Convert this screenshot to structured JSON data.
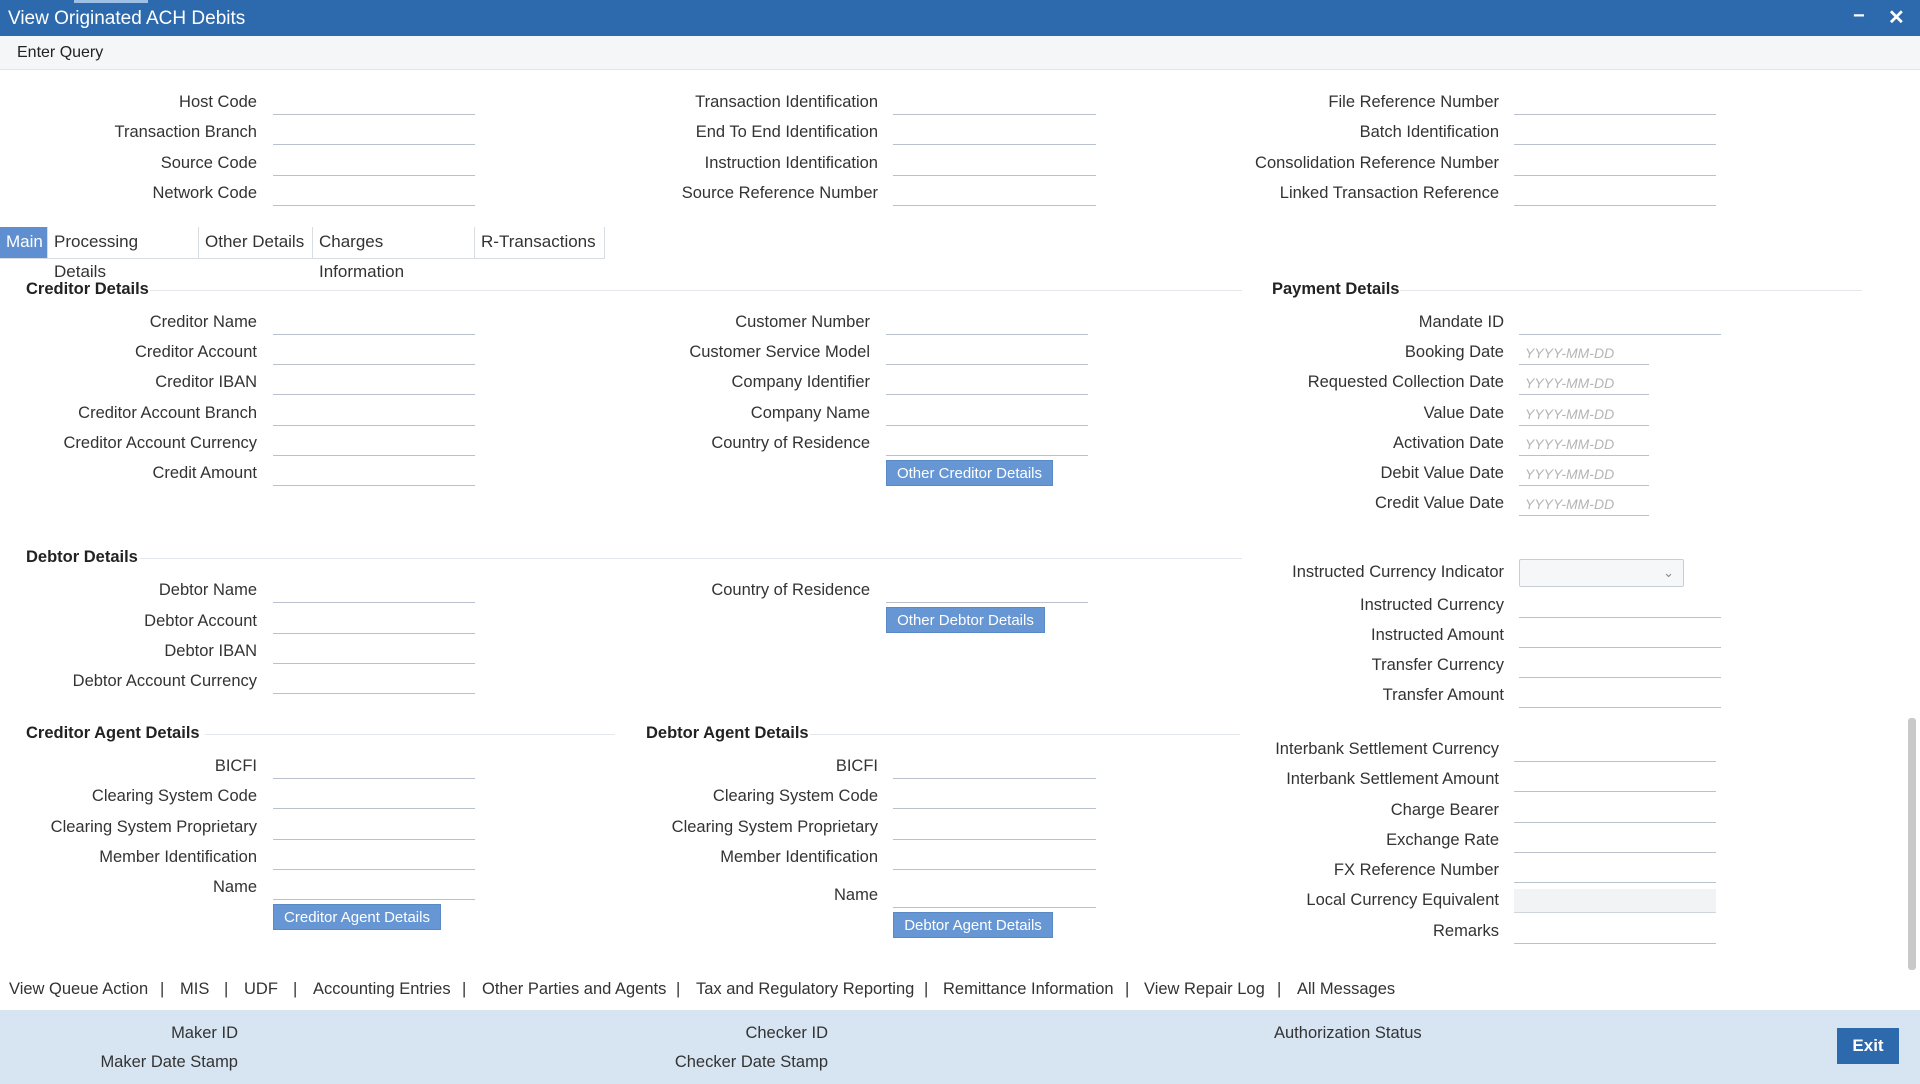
{
  "window": {
    "title": "View Originated ACH Debits",
    "minimize": "−",
    "close": "✕"
  },
  "query": {
    "enter_query": "Enter Query"
  },
  "header_fields": {
    "host_code": "Host Code",
    "transaction_branch": "Transaction Branch",
    "source_code": "Source Code",
    "network_code": "Network Code",
    "transaction_identification": "Transaction Identification",
    "end_to_end_identification": "End To End Identification",
    "instruction_identification": "Instruction Identification",
    "source_reference_number": "Source Reference Number",
    "file_reference_number": "File Reference Number",
    "batch_identification": "Batch Identification",
    "consolidation_reference_number": "Consolidation Reference Number",
    "linked_transaction_reference": "Linked Transaction Reference"
  },
  "tabs": [
    "Main",
    "Processing Details",
    "Other Details",
    "Charges Information",
    "R-Transactions"
  ],
  "creditor_details": {
    "title": "Creditor Details",
    "creditor_name": "Creditor Name",
    "creditor_account": "Creditor Account",
    "creditor_iban": "Creditor IBAN",
    "creditor_account_branch": "Creditor Account Branch",
    "creditor_account_currency": "Creditor Account Currency",
    "credit_amount": "Credit Amount",
    "customer_number": "Customer Number",
    "customer_service_model": "Customer Service Model",
    "company_identifier": "Company Identifier",
    "company_name": "Company Name",
    "country_of_residence": "Country of Residence",
    "other_creditor_details_button": "Other Creditor Details"
  },
  "payment_details": {
    "title": "Payment Details",
    "mandate_id": "Mandate ID",
    "booking_date": "Booking Date",
    "requested_collection_date": "Requested Collection Date",
    "value_date": "Value Date",
    "activation_date": "Activation Date",
    "debit_value_date": "Debit Value Date",
    "credit_value_date": "Credit Value Date",
    "date_placeholder": "YYYY-MM-DD",
    "instructed_currency_indicator": "Instructed Currency Indicator",
    "instructed_currency": "Instructed Currency",
    "instructed_amount": "Instructed Amount",
    "transfer_currency": "Transfer Currency",
    "transfer_amount": "Transfer Amount",
    "interbank_settlement_currency": "Interbank Settlement Currency",
    "interbank_settlement_amount": "Interbank Settlement Amount",
    "charge_bearer": "Charge Bearer",
    "exchange_rate": "Exchange Rate",
    "fx_reference_number": "FX Reference Number",
    "local_currency_equivalent": "Local Currency Equivalent",
    "remarks": "Remarks"
  },
  "debtor_details": {
    "title": "Debtor Details",
    "debtor_name": "Debtor Name",
    "debtor_account": "Debtor Account",
    "debtor_iban": "Debtor IBAN",
    "debtor_account_currency": "Debtor Account Currency",
    "country_of_residence": "Country of Residence",
    "other_debtor_details_button": "Other Debtor Details"
  },
  "creditor_agent": {
    "title": "Creditor Agent Details",
    "bicfi": "BICFI",
    "clearing_system_code": "Clearing System Code",
    "clearing_system_proprietary": "Clearing System Proprietary",
    "member_identification": "Member Identification",
    "name": "Name",
    "button": "Creditor Agent Details"
  },
  "debtor_agent": {
    "title": "Debtor Agent Details",
    "bicfi": "BICFI",
    "clearing_system_code": "Clearing System Code",
    "clearing_system_proprietary": "Clearing System Proprietary",
    "member_identification": "Member Identification",
    "name": "Name",
    "button": "Debtor Agent Details"
  },
  "bottom_links": [
    "View Queue Action",
    "MIS",
    "UDF",
    "Accounting Entries",
    "Other Parties and Agents",
    "Tax and Regulatory Reporting",
    "Remittance Information",
    "View Repair Log",
    "All Messages"
  ],
  "link_separator": "|",
  "footer": {
    "maker_id": "Maker ID",
    "maker_date_stamp": "Maker Date Stamp",
    "checker_id": "Checker ID",
    "checker_date_stamp": "Checker Date Stamp",
    "authorization_status": "Authorization Status",
    "exit": "Exit"
  },
  "colors": {
    "title_bar": "#2d6aad",
    "accent_button": "#6696d3",
    "footer": "#d7e5f3",
    "active_tab": "#5f8fd0"
  }
}
